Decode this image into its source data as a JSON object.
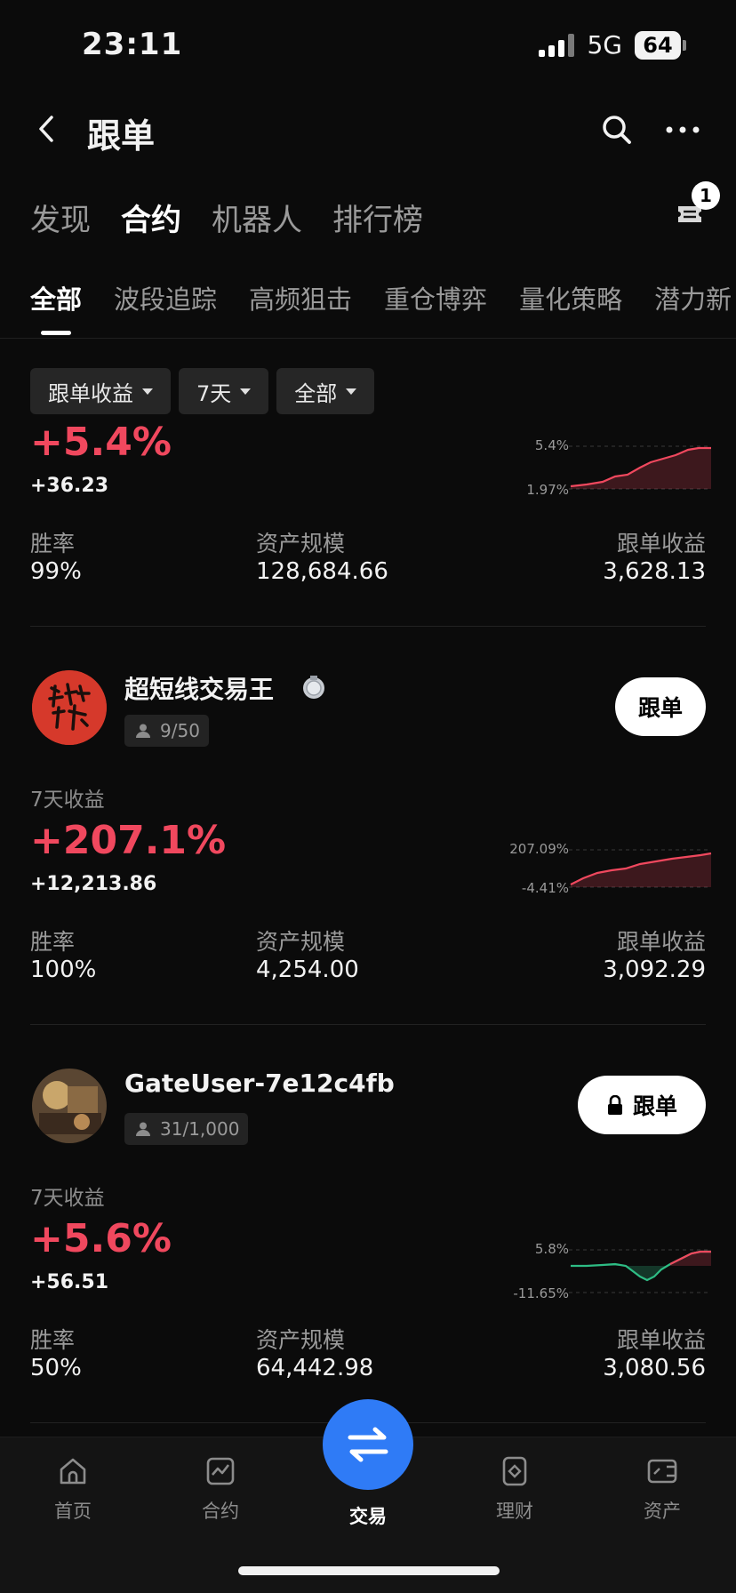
{
  "status_bar": {
    "time": "23:11",
    "network": "5G",
    "battery": "64"
  },
  "header": {
    "title": "跟单"
  },
  "top_tabs": [
    "发现",
    "合约",
    "机器人",
    "排行榜"
  ],
  "active_top_tab": "合约",
  "ticket_badge": "1",
  "sub_tabs": [
    "全部",
    "波段追踪",
    "高频狙击",
    "重仓博弈",
    "量化策略",
    "潜力新"
  ],
  "filters": [
    "跟单收益",
    "7天",
    "全部"
  ],
  "stat_labels": {
    "win_rate": "胜率",
    "aum": "资产规模",
    "copy_profit": "跟单收益"
  },
  "cards": [
    {
      "return_pct": "+5.4%",
      "pnl": "+36.23",
      "spark_max": "5.4%",
      "spark_min": "1.97%",
      "win_rate": "99%",
      "aum": "128,684.66",
      "copy_profit": "3,628.13"
    },
    {
      "name": "超短线交易王",
      "followers": "9/50",
      "button": "跟单",
      "period_label": "7天收益",
      "return_pct": "+207.1%",
      "pnl": "+12,213.86",
      "spark_max": "207.09%",
      "spark_min": "-4.41%",
      "win_rate": "100%",
      "aum": "4,254.00",
      "copy_profit": "3,092.29"
    },
    {
      "name": "GateUser-7e12c4fb",
      "followers": "31/1,000",
      "button": "跟单",
      "period_label": "7天收益",
      "return_pct": "+5.6%",
      "pnl": "+56.51",
      "spark_max": "5.8%",
      "spark_min": "-11.65%",
      "win_rate": "50%",
      "aum": "64,442.98",
      "copy_profit": "3,080.56"
    }
  ],
  "bottom_nav": [
    "首页",
    "合约",
    "交易",
    "理财",
    "资产"
  ],
  "colors": {
    "positive": "#f0485e",
    "negative": "#2ebd85",
    "accent": "#2f7bf6"
  }
}
